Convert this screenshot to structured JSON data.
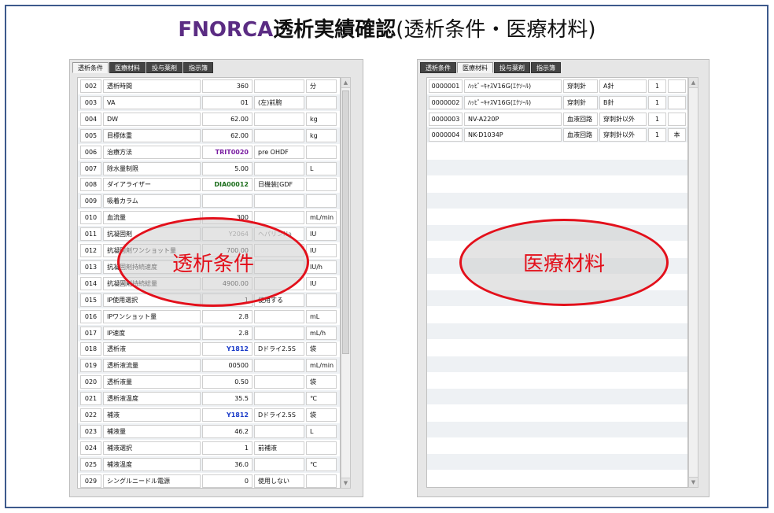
{
  "title": {
    "brand": "FNORCA",
    "main": "透析実績確認",
    "sub": "(透析条件・医療材料)"
  },
  "left_panel": {
    "tabs": [
      {
        "label": "透析条件",
        "active": true
      },
      {
        "label": "医療材料",
        "active": false
      },
      {
        "label": "投与薬剤",
        "active": false
      },
      {
        "label": "指示簿",
        "active": false
      }
    ],
    "rows": [
      {
        "code": "002",
        "name": "透析時間",
        "value": "360",
        "note": "",
        "unit": "分"
      },
      {
        "code": "003",
        "name": "VA",
        "value": "01",
        "note": "(左)前腕",
        "unit": ""
      },
      {
        "code": "004",
        "name": "DW",
        "value": "62.00",
        "note": "",
        "unit": "kg"
      },
      {
        "code": "005",
        "name": "目標体重",
        "value": "62.00",
        "note": "",
        "unit": "kg"
      },
      {
        "code": "006",
        "name": "治療方法",
        "value": "TRIT0020",
        "value_style": "purple",
        "note": "pre OHDF",
        "unit": ""
      },
      {
        "code": "007",
        "name": "除水量制限",
        "value": "5.00",
        "note": "",
        "unit": "L"
      },
      {
        "code": "008",
        "name": "ダイアライザー",
        "value": "DIA00012",
        "value_style": "green",
        "note": "日機装[GDF",
        "unit": ""
      },
      {
        "code": "009",
        "name": "吸着カラム",
        "value": "",
        "note": "",
        "unit": ""
      },
      {
        "code": "010",
        "name": "血流量",
        "value": "300",
        "note": "",
        "unit": "mL/min"
      },
      {
        "code": "011",
        "name": "抗凝固剤",
        "value": "Y2064",
        "value_style": "grey",
        "note": "ヘパリンNa",
        "note_style": "grey",
        "unit": "IU"
      },
      {
        "code": "012",
        "name": "抗凝固剤ワンショット量",
        "value": "700.00",
        "note": "",
        "unit": "IU"
      },
      {
        "code": "013",
        "name": "抗凝固剤持続速度",
        "value": "",
        "note": "",
        "unit": "IU/h"
      },
      {
        "code": "014",
        "name": "抗凝固剤持続総量",
        "value": "4900.00",
        "note": "",
        "unit": "IU"
      },
      {
        "code": "015",
        "name": "IP使用選択",
        "value": "1",
        "note": "使用する",
        "unit": ""
      },
      {
        "code": "016",
        "name": "IPワンショット量",
        "value": "2.8",
        "note": "",
        "unit": "mL"
      },
      {
        "code": "017",
        "name": "IP速度",
        "value": "2.8",
        "note": "",
        "unit": "mL/h"
      },
      {
        "code": "018",
        "name": "透析液",
        "value": "Y1812",
        "value_style": "blue",
        "note": "Dドライ2.5S",
        "unit": "袋"
      },
      {
        "code": "019",
        "name": "透析液流量",
        "value": "00500",
        "note": "",
        "unit": "mL/min"
      },
      {
        "code": "020",
        "name": "透析液量",
        "value": "0.50",
        "note": "",
        "unit": "袋"
      },
      {
        "code": "021",
        "name": "透析液温度",
        "value": "35.5",
        "note": "",
        "unit": "℃"
      },
      {
        "code": "022",
        "name": "補液",
        "value": "Y1812",
        "value_style": "blue",
        "note": "Dドライ2.5S",
        "unit": "袋"
      },
      {
        "code": "023",
        "name": "補液量",
        "value": "46.2",
        "note": "",
        "unit": "L"
      },
      {
        "code": "024",
        "name": "補液選択",
        "value": "1",
        "note": "前補液",
        "unit": ""
      },
      {
        "code": "025",
        "name": "補液温度",
        "value": "36.0",
        "note": "",
        "unit": "℃"
      },
      {
        "code": "029",
        "name": "シングルニードル電源",
        "value": "0",
        "note": "使用しない",
        "unit": ""
      }
    ],
    "annotation": "透析条件"
  },
  "right_panel": {
    "tabs": [
      {
        "label": "透析条件",
        "active": false
      },
      {
        "label": "医療材料",
        "active": true
      },
      {
        "label": "投与薬剤",
        "active": false
      },
      {
        "label": "指示簿",
        "active": false
      }
    ],
    "rows": [
      {
        "code": "0000001",
        "name": "ﾊｯﾋﾟｰｷｬｽV16G(ｴｸｿｰﾙ)",
        "category": "穿刺針",
        "sub": "A針",
        "qty": "1",
        "unit": ""
      },
      {
        "code": "0000002",
        "name": "ﾊｯﾋﾟｰｷｬｽV16G(ｴｸｿｰﾙ)",
        "category": "穿刺針",
        "sub": "B針",
        "qty": "1",
        "unit": ""
      },
      {
        "code": "0000003",
        "name": "NV-A220P",
        "category": "血液回路",
        "sub": "穿刺針以外",
        "qty": "1",
        "unit": ""
      },
      {
        "code": "0000004",
        "name": "NK-D1034P",
        "category": "血液回路",
        "sub": "穿刺針以外",
        "qty": "1",
        "unit": "本"
      }
    ],
    "empty_rows": 21,
    "annotation": "医療材料"
  },
  "colors": {
    "frame": "#3d5a8c",
    "brand": "#5b2c83",
    "annotation_red": "#e3101b",
    "purple": "#7a1fa2",
    "green": "#1c6e1c",
    "blue": "#1b3cc9"
  },
  "icons": {
    "scroll_up": "triangle-up",
    "scroll_down": "triangle-down"
  }
}
